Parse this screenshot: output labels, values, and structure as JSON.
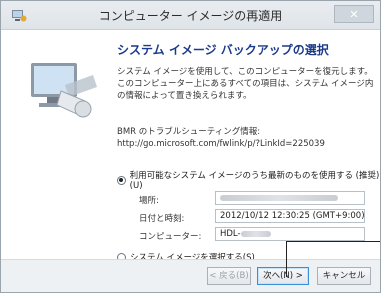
{
  "window": {
    "title": "コンピューター イメージの再適用",
    "close_glyph": "✕"
  },
  "header": {
    "heading": "システム イメージ バックアップの選択",
    "description": "システム イメージを使用して、このコンピューターを復元します。このコンピューター上にあるすべての項目は、システム イメージ内の情報によって置き換えられます。"
  },
  "bmr": {
    "label": "BMR のトラブルシューティング情報:",
    "url": "http://go.microsoft.com/fwlink/p/?LinkId=225039"
  },
  "options": {
    "latest_label": "利用可能なシステム イメージのうち最新のものを使用する (推奨)(U)",
    "select_label": "システム イメージを選択する(S)"
  },
  "fields": {
    "location_label": "場所:",
    "datetime_label": "日付と時刻:",
    "datetime_value": "2012/10/12 12:30:25 (GMT+9:00)",
    "computer_label": "コンピューター:",
    "computer_value": "HDL-"
  },
  "buttons": {
    "back": "< 戻る(B)",
    "next": "次へ(N) >",
    "cancel": "キャンセル"
  },
  "colors": {
    "heading": "#1b3a8a",
    "focus_border": "#3b8fd6"
  },
  "icons": {
    "app": "backup-app-icon",
    "side_art": "computer-restore-illustration"
  }
}
